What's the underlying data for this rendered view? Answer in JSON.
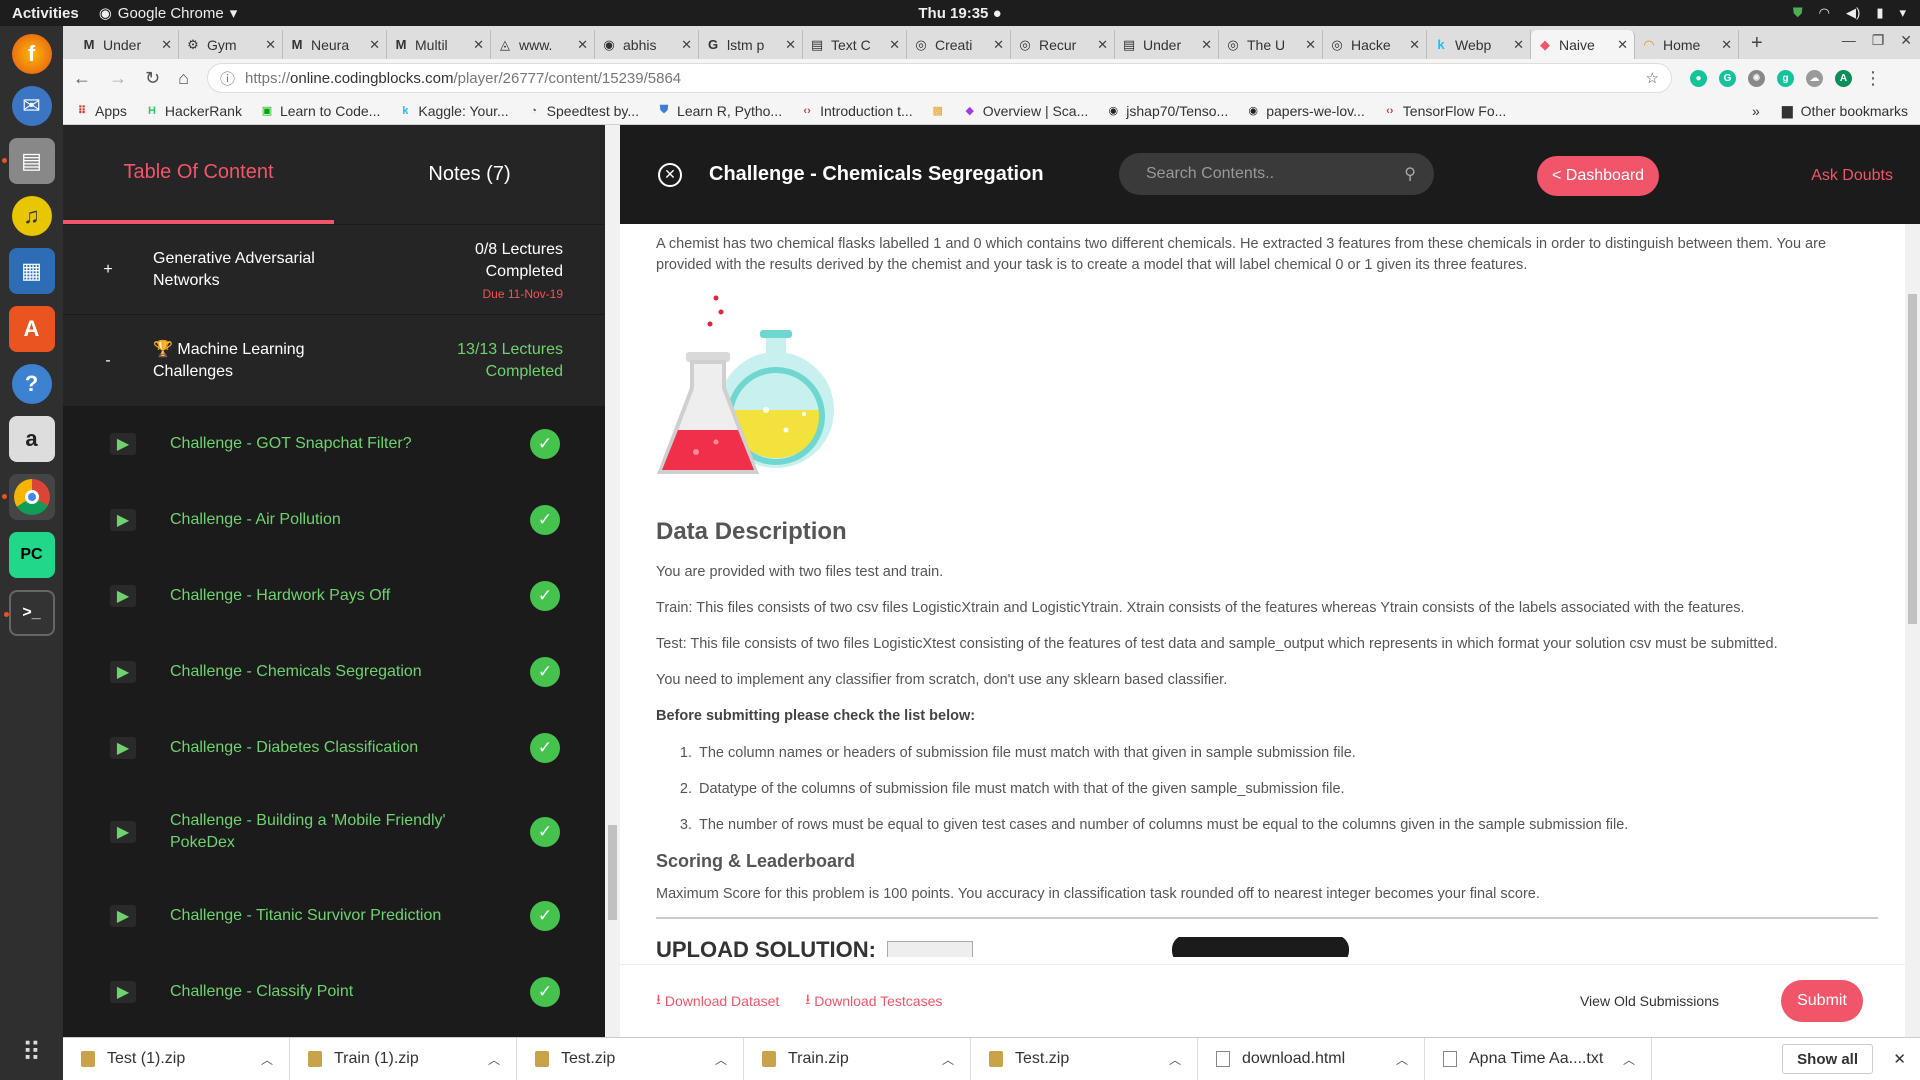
{
  "os": {
    "activities": "Activities",
    "app_name": "Google Chrome",
    "clock": "Thu 19:35"
  },
  "browser": {
    "tabs": [
      {
        "label": "Under",
        "icon": "medium-icon"
      },
      {
        "label": "Gym",
        "icon": "openai-icon"
      },
      {
        "label": "Neura",
        "icon": "medium-icon"
      },
      {
        "label": "Multil",
        "icon": "medium-icon"
      },
      {
        "label": "www.",
        "icon": "link-icon"
      },
      {
        "label": "abhis",
        "icon": "github-icon"
      },
      {
        "label": "lstm p",
        "icon": "google-icon"
      },
      {
        "label": "Text C",
        "icon": "page-icon"
      },
      {
        "label": "Creati",
        "icon": "globe-icon"
      },
      {
        "label": "Recur",
        "icon": "globe-icon"
      },
      {
        "label": "Under",
        "icon": "page-icon"
      },
      {
        "label": "The U",
        "icon": "globe-icon"
      },
      {
        "label": "Hacke",
        "icon": "globe-icon"
      },
      {
        "label": "Webp",
        "icon": "kaggle-icon"
      },
      {
        "label": "Naive",
        "icon": "codingblocks-icon",
        "active": true
      },
      {
        "label": "Home",
        "icon": "loading-icon"
      }
    ],
    "url_scheme": "https://",
    "url_host": "online.codingblocks.com",
    "url_path": "/player/26777/content/15239/5864",
    "bookmarks": [
      {
        "label": "Apps",
        "icon": "apps-icon"
      },
      {
        "label": "HackerRank",
        "icon": "hackerrank-icon"
      },
      {
        "label": "Learn to Code...",
        "icon": "code-icon"
      },
      {
        "label": "Kaggle: Your...",
        "icon": "kaggle-icon"
      },
      {
        "label": "Speedtest by...",
        "icon": "speedtest-icon"
      },
      {
        "label": "Learn R, Pytho...",
        "icon": "shield-icon"
      },
      {
        "label": "Introduction t...",
        "icon": "code-brackets-icon"
      },
      {
        "label": "",
        "icon": "bookmark-icon"
      },
      {
        "label": "Overview | Sca...",
        "icon": "cube-icon"
      },
      {
        "label": "jshap70/Tenso...",
        "icon": "github-icon"
      },
      {
        "label": "papers-we-lov...",
        "icon": "github-icon"
      },
      {
        "label": "TensorFlow Fo...",
        "icon": "code-brackets-icon"
      }
    ],
    "other_bookmarks": "Other bookmarks"
  },
  "sidebar": {
    "tabs": [
      "Table Of Content",
      "Notes (7)"
    ],
    "modules": [
      {
        "toggle": "+",
        "title": "Generative Adversarial Networks",
        "progress_line1": "0/8 Lectures",
        "progress_line2": "Completed",
        "due": "Due 11-Nov-19"
      },
      {
        "toggle": "-",
        "title": "🏆 Machine Learning Challenges",
        "progress_line1": "13/13 Lectures",
        "progress_line2": "Completed"
      }
    ],
    "lectures": [
      "Challenge - GOT Snapchat Filter?",
      "Challenge - Air Pollution",
      "Challenge - Hardwork Pays Off",
      "Challenge - Chemicals Segregation",
      "Challenge - Diabetes Classification",
      "Challenge - Building a 'Mobile Friendly' PokeDex",
      "Challenge - Titanic Survivor Prediction",
      "Challenge - Classify Point"
    ]
  },
  "main": {
    "title": "Challenge - Chemicals Segregation",
    "search_placeholder": "Search Contents..",
    "dashboard": "< Dashboard",
    "ask_doubts": "Ask Doubts",
    "intro": "A chemist has two chemical flasks labelled 1 and 0 which contains two different chemicals. He extracted 3 features from these chemicals in order to distinguish between them. You are provided with the results derived by the chemist and your task is to create a model that will label chemical 0 or 1 given its three features.",
    "data_heading": "Data Description",
    "p1": "You are provided with two files test and train.",
    "p2": "Train: This files consists of two csv files LogisticXtrain and LogisticYtrain. Xtrain consists of the features whereas Ytrain consists of the labels associated with the features.",
    "p3": "Test: This file consists of two files LogisticXtest consisting of the features of test data and sample_output which represents in which format your solution csv must be submitted.",
    "p4": "You need to implement any classifier from scratch, don't use any sklearn based classifier.",
    "checklist_heading": "Before submitting please check the list below:",
    "checklist": [
      "The column names or headers of submission file must match with that given in sample submission file.",
      "Datatype of the columns of submission file must match with that of the given sample_submission file.",
      "The number of rows must be equal to given test cases and number of columns must be equal to the columns given in the sample submission file."
    ],
    "scoring_heading": "Scoring & Leaderboard",
    "scoring_text": "Maximum Score for this problem is 100 points. You accuracy in classification task rounded off to nearest integer becomes your final score.",
    "upload_label": "UPLOAD SOLUTION:",
    "download_dataset": "Download Dataset",
    "download_testcases": "Download Testcases",
    "view_old": "View Old Submissions",
    "submit": "Submit"
  },
  "downloads": {
    "items": [
      {
        "name": "Test (1).zip",
        "type": "zip"
      },
      {
        "name": "Train (1).zip",
        "type": "zip"
      },
      {
        "name": "Test.zip",
        "type": "zip"
      },
      {
        "name": "Train.zip",
        "type": "zip"
      },
      {
        "name": "Test.zip",
        "type": "zip"
      },
      {
        "name": "download.html",
        "type": "file"
      },
      {
        "name": "Apna Time Aa....txt",
        "type": "file"
      }
    ],
    "show_all": "Show all"
  },
  "colors": {
    "accent": "#f1556a",
    "complete": "#6ed36e",
    "sidebar_bg": "#1b1b1b"
  }
}
